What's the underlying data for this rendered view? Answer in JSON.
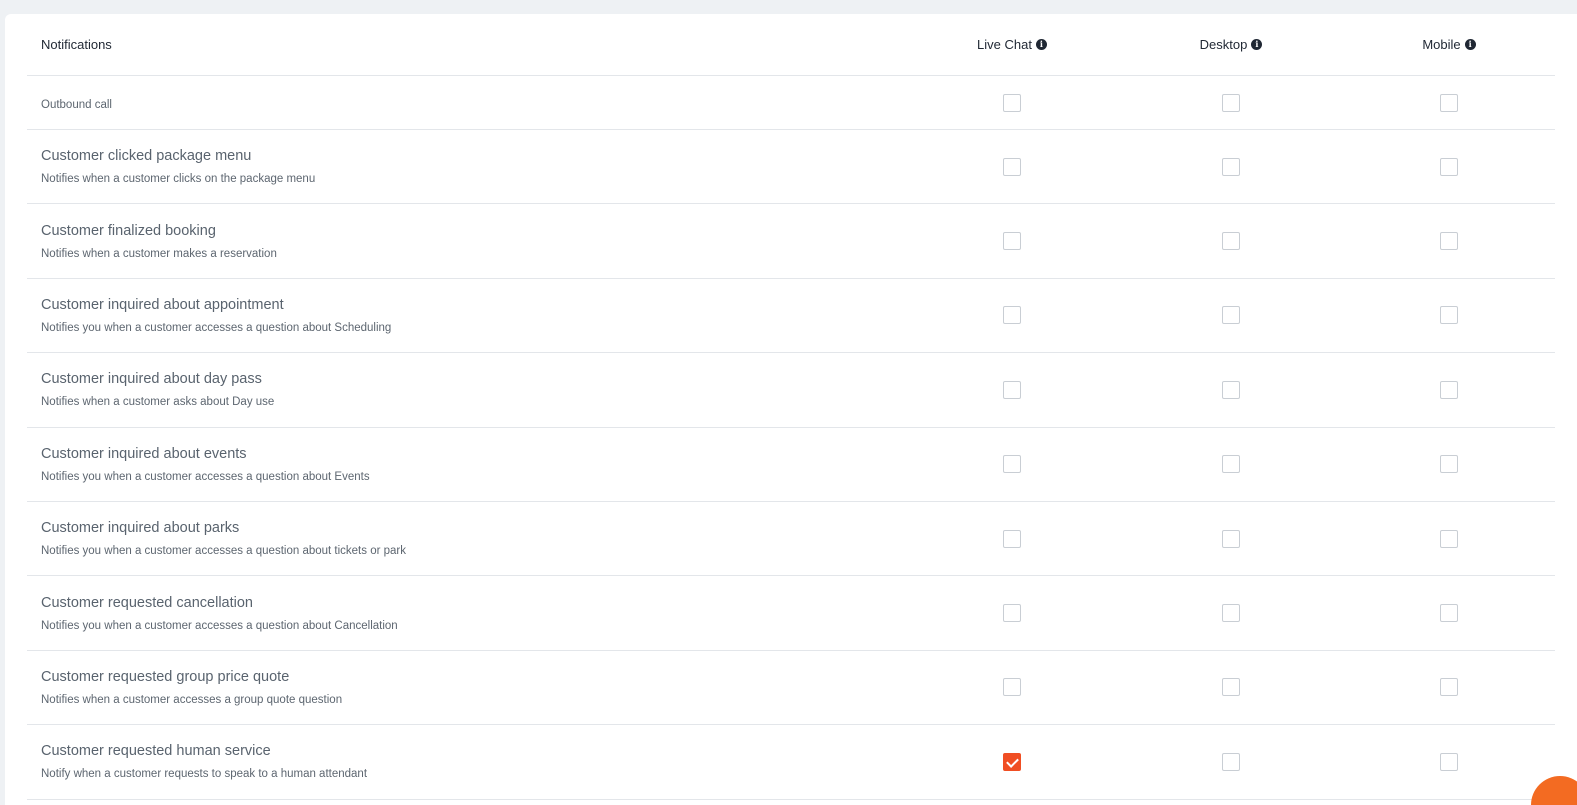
{
  "header": {
    "notifications": "Notifications",
    "columns": [
      "Live Chat",
      "Desktop",
      "Mobile"
    ]
  },
  "rows": [
    {
      "title": "",
      "desc": "Outbound call",
      "checked": [
        false,
        false,
        false
      ]
    },
    {
      "title": "Customer clicked package menu",
      "desc": "Notifies when a customer clicks on the package menu",
      "checked": [
        false,
        false,
        false
      ]
    },
    {
      "title": "Customer finalized booking",
      "desc": "Notifies when a customer makes a reservation",
      "checked": [
        false,
        false,
        false
      ]
    },
    {
      "title": "Customer inquired about appointment",
      "desc": "Notifies you when a customer accesses a question about Scheduling",
      "checked": [
        false,
        false,
        false
      ]
    },
    {
      "title": "Customer inquired about day pass",
      "desc": "Notifies when a customer asks about Day use",
      "checked": [
        false,
        false,
        false
      ]
    },
    {
      "title": "Customer inquired about events",
      "desc": "Notifies you when a customer accesses a question about Events",
      "checked": [
        false,
        false,
        false
      ]
    },
    {
      "title": "Customer inquired about parks",
      "desc": "Notifies you when a customer accesses a question about tickets or park",
      "checked": [
        false,
        false,
        false
      ]
    },
    {
      "title": "Customer requested cancellation",
      "desc": "Notifies you when a customer accesses a question about Cancellation",
      "checked": [
        false,
        false,
        false
      ]
    },
    {
      "title": "Customer requested group price quote",
      "desc": "Notifies when a customer accesses a group quote question",
      "checked": [
        false,
        false,
        false
      ]
    },
    {
      "title": "Customer requested human service",
      "desc": "Notify when a customer requests to speak to a human attendant",
      "checked": [
        true,
        false,
        false
      ]
    }
  ],
  "colors": {
    "accent": "#f04e23",
    "fab": "#f36b22"
  }
}
